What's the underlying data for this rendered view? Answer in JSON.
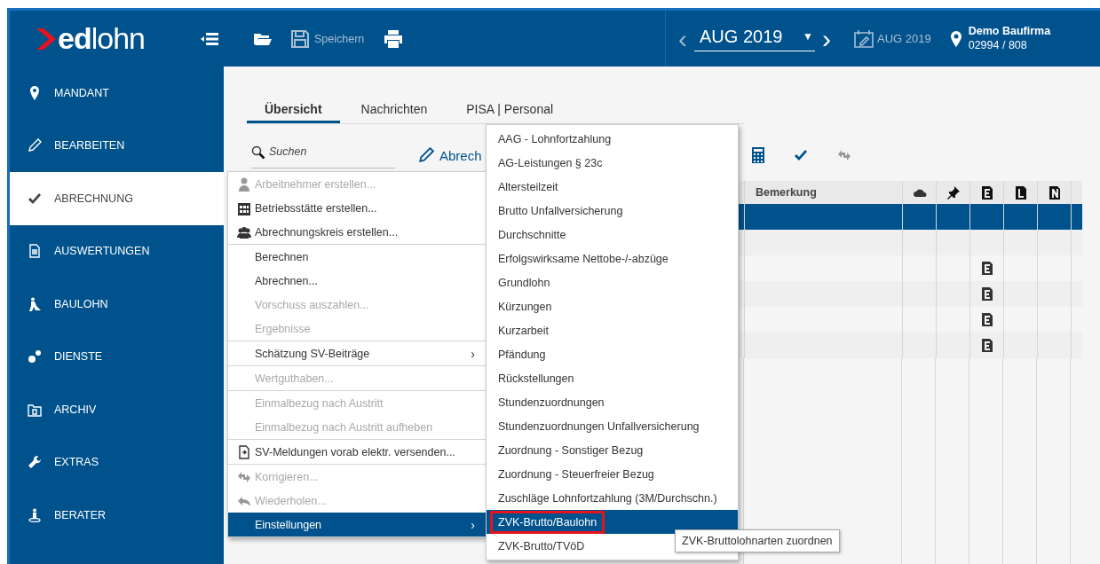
{
  "topbar": {
    "logo": "**ed**lohn",
    "save_label": "Speichern",
    "save_disabled": true,
    "period": "AUG 2019",
    "period_caret": "▼",
    "prev": "‹",
    "next": "›",
    "booked_period": "AUG 2019",
    "company_name": "Demo Baufirma",
    "company_number": "02994 / 808"
  },
  "sidebar": {
    "items": [
      {
        "label": "MANDANT",
        "selected": false
      },
      {
        "label": "BEARBEITEN",
        "selected": false
      },
      {
        "label": "ABRECHNUNG",
        "selected": true
      },
      {
        "label": "AUSWERTUNGEN",
        "selected": false
      },
      {
        "label": "BAULOHN",
        "selected": false
      },
      {
        "label": "DIENSTE",
        "selected": false
      },
      {
        "label": "ARCHIV",
        "selected": false
      },
      {
        "label": "EXTRAS",
        "selected": false
      },
      {
        "label": "BERATER",
        "selected": false
      }
    ]
  },
  "tabs": [
    {
      "label": "Übersicht",
      "selected": true
    },
    {
      "label": "Nachrichten",
      "selected": false
    },
    {
      "label": "PISA | Personal",
      "selected": false
    }
  ],
  "search": {
    "placeholder": "Suchen"
  },
  "toolbar": {
    "action_label": "Abrech"
  },
  "table": {
    "columns": [
      {
        "kind": "text",
        "label": "Bemerkung"
      },
      {
        "kind": "icon"
      },
      {
        "kind": "icon"
      },
      {
        "kind": "icon"
      },
      {
        "kind": "icon"
      },
      {
        "kind": "icon"
      }
    ],
    "rows": [
      {
        "selected": true,
        "e_document": false
      },
      {
        "selected": false,
        "e_document": false
      },
      {
        "selected": false,
        "e_document": true
      },
      {
        "selected": false,
        "e_document": true
      },
      {
        "selected": false,
        "e_document": true
      },
      {
        "selected": false,
        "e_document": true
      }
    ]
  },
  "context_menu": {
    "groups": [
      [
        {
          "label": "Arbeitnehmer erstellen...",
          "disabled": true,
          "submenu": false,
          "selected": false
        },
        {
          "label": "Betriebsstätte erstellen...",
          "disabled": false,
          "submenu": false,
          "selected": false
        },
        {
          "label": "Abrechnungskreis erstellen...",
          "disabled": false,
          "submenu": false,
          "selected": false
        }
      ],
      [
        {
          "label": "Berechnen",
          "disabled": false,
          "submenu": false,
          "selected": false
        },
        {
          "label": "Abrechnen...",
          "disabled": false,
          "submenu": false,
          "selected": false
        },
        {
          "label": "Vorschuss auszahlen...",
          "disabled": true,
          "submenu": false,
          "selected": false
        },
        {
          "label": "Ergebnisse",
          "disabled": true,
          "submenu": false,
          "selected": false
        }
      ],
      [
        {
          "label": "Schätzung SV-Beiträge",
          "disabled": false,
          "submenu": true,
          "selected": false
        }
      ],
      [
        {
          "label": "Wertguthaben...",
          "disabled": true,
          "submenu": false,
          "selected": false
        }
      ],
      [
        {
          "label": "Einmalbezug nach Austritt",
          "disabled": true,
          "submenu": false,
          "selected": false
        },
        {
          "label": "Einmalbezug nach Austritt aufheben",
          "disabled": true,
          "submenu": false,
          "selected": false
        }
      ],
      [
        {
          "label": "SV-Meldungen vorab elektr. versenden...",
          "disabled": false,
          "submenu": false,
          "selected": false
        }
      ],
      [
        {
          "label": "Korrigieren...",
          "disabled": true,
          "submenu": false,
          "selected": false
        },
        {
          "label": "Wiederholen...",
          "disabled": true,
          "submenu": false,
          "selected": false
        },
        {
          "label": "Einstellungen",
          "disabled": false,
          "submenu": true,
          "selected": true
        }
      ]
    ],
    "submenu_arrow": "›"
  },
  "submenu": {
    "items": [
      {
        "label": "AAG - Lohnfortzahlung",
        "selected": false,
        "outlined": false
      },
      {
        "label": "AG-Leistungen § 23c",
        "selected": false,
        "outlined": false
      },
      {
        "label": "Altersteilzeit",
        "selected": false,
        "outlined": false
      },
      {
        "label": "Brutto Unfallversicherung",
        "selected": false,
        "outlined": false
      },
      {
        "label": "Durchschnitte",
        "selected": false,
        "outlined": false
      },
      {
        "label": "Erfolgswirksame Nettobe-/-abzüge",
        "selected": false,
        "outlined": false
      },
      {
        "label": "Grundlohn",
        "selected": false,
        "outlined": false
      },
      {
        "label": "Kürzungen",
        "selected": false,
        "outlined": false
      },
      {
        "label": "Kurzarbeit",
        "selected": false,
        "outlined": false
      },
      {
        "label": "Pfändung",
        "selected": false,
        "outlined": false
      },
      {
        "label": "Rückstellungen",
        "selected": false,
        "outlined": false
      },
      {
        "label": "Stundenzuordnungen",
        "selected": false,
        "outlined": false
      },
      {
        "label": "Stundenzuordnungen Unfallversicherung",
        "selected": false,
        "outlined": false
      },
      {
        "label": "Zuordnung - Sonstiger Bezug",
        "selected": false,
        "outlined": false
      },
      {
        "label": "Zuordnung - Steuerfreier Bezug",
        "selected": false,
        "outlined": false
      },
      {
        "label": "Zuschläge Lohnfortzahlung (3M/Durchschn.)",
        "selected": false,
        "outlined": false
      },
      {
        "label": "ZVK-Brutto/Baulohn",
        "selected": true,
        "outlined": true
      },
      {
        "label": "ZVK-Brutto/TVöD",
        "selected": false,
        "outlined": false
      }
    ]
  },
  "tooltip": {
    "text": "ZVK-Bruttolohnarten zuordnen"
  }
}
